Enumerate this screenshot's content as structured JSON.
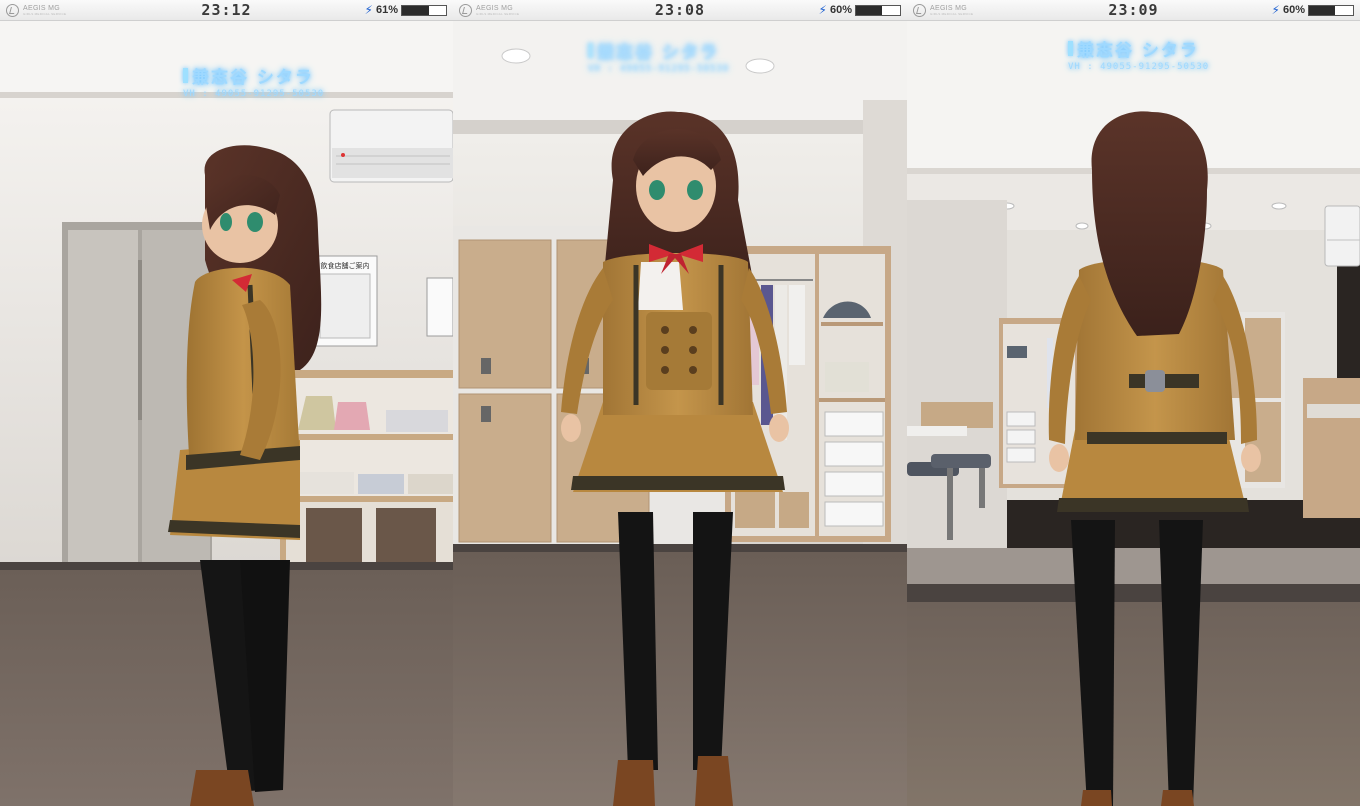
{
  "app": {
    "logo_text": "AEGIS MG",
    "logo_sub": "GIRLS MEDICAL SERVICE"
  },
  "panels": [
    {
      "view": "side",
      "status": {
        "time": "23:12",
        "battery_label": "61%",
        "battery_level": 0.61
      },
      "nameplate": {
        "name": "兼志谷 シタラ",
        "vh": "VH : 49055-91295-50530"
      },
      "room_sign": "飲食店舗ご案内"
    },
    {
      "view": "front",
      "status": {
        "time": "23:08",
        "battery_label": "60%",
        "battery_level": 0.6
      },
      "nameplate": {
        "name": "兼志谷 シタラ",
        "vh": "VH : 49055-91295-50530"
      }
    },
    {
      "view": "back",
      "status": {
        "time": "23:09",
        "battery_label": "60%",
        "battery_level": 0.6
      },
      "nameplate": {
        "name": "兼志谷 シタラ",
        "vh": "VH : 49055-91295-50530"
      }
    }
  ],
  "colors": {
    "hud_text": "#9fd9ff",
    "uniform": "#b8883f",
    "uniform_trim": "#3b3526",
    "hair": "#4a2a22",
    "stockings": "#141414",
    "shoes": "#7a4622",
    "ribbon": "#d32a35",
    "floor": "#6e6259",
    "wall": "#e9e6e2"
  }
}
